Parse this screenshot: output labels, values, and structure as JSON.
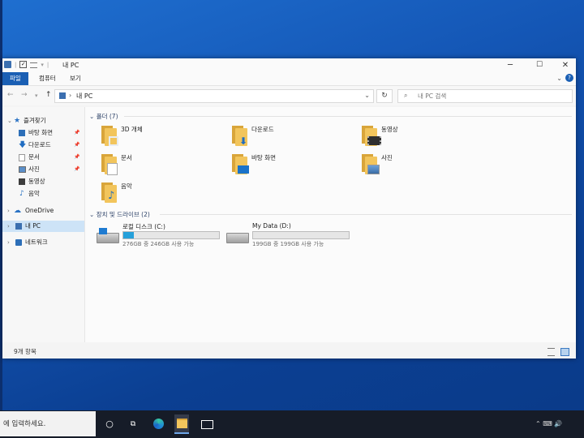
{
  "window": {
    "title": "내 PC",
    "controls": {
      "minimize": "─",
      "maximize": "☐",
      "close": "✕"
    }
  },
  "ribbon": {
    "tabs": [
      "파일",
      "컴퓨터",
      "보기"
    ],
    "collapse_glyph": "⌄",
    "help_glyph": "?"
  },
  "address": {
    "path": "내 PC",
    "search_placeholder": "내 PC 검색"
  },
  "sidebar": {
    "quick_access": "즐겨찾기",
    "items": [
      {
        "label": "바탕 화면",
        "icon": "desktop-icon",
        "pinned": true
      },
      {
        "label": "다운로드",
        "icon": "download-icon",
        "pinned": true
      },
      {
        "label": "문서",
        "icon": "documents-icon",
        "pinned": true
      },
      {
        "label": "사진",
        "icon": "pictures-icon",
        "pinned": true
      },
      {
        "label": "동영상",
        "icon": "videos-icon",
        "pinned": false
      },
      {
        "label": "음악",
        "icon": "music-icon",
        "pinned": false
      }
    ],
    "onedrive": "OneDrive",
    "this_pc": "내 PC",
    "network": "네트워크"
  },
  "content": {
    "folders_header": "폴더 (7)",
    "folders": [
      {
        "label": "3D 개체",
        "icon": "3d-objects-folder-icon"
      },
      {
        "label": "다운로드",
        "icon": "downloads-folder-icon"
      },
      {
        "label": "동영상",
        "icon": "videos-folder-icon"
      },
      {
        "label": "문서",
        "icon": "documents-folder-icon"
      },
      {
        "label": "바탕 화면",
        "icon": "desktop-folder-icon"
      },
      {
        "label": "사진",
        "icon": "pictures-folder-icon"
      },
      {
        "label": "음악",
        "icon": "music-folder-icon"
      }
    ],
    "drives_header": "장치 및 드라이브 (2)",
    "drives": [
      {
        "label": "로컬 디스크 (C:)",
        "free_text": "276GB 중 246GB 사용 가능",
        "used_fraction": 0.11,
        "icon": "windows-drive-icon"
      },
      {
        "label": "My Data (D:)",
        "free_text": "199GB 중 199GB 사용 가능",
        "used_fraction": 0.0,
        "icon": "hard-drive-icon"
      }
    ]
  },
  "status": {
    "item_count": "9개 항목"
  },
  "taskbar": {
    "search_text": "에 입력하세요.",
    "icons": [
      "cortana-icon",
      "task-view-icon",
      "edge-icon",
      "file-explorer-icon",
      "mail-icon"
    ]
  },
  "colors": {
    "accent": "#1a5fb4",
    "drive_fill": "#26a0da",
    "folder": "#f2c55c"
  }
}
